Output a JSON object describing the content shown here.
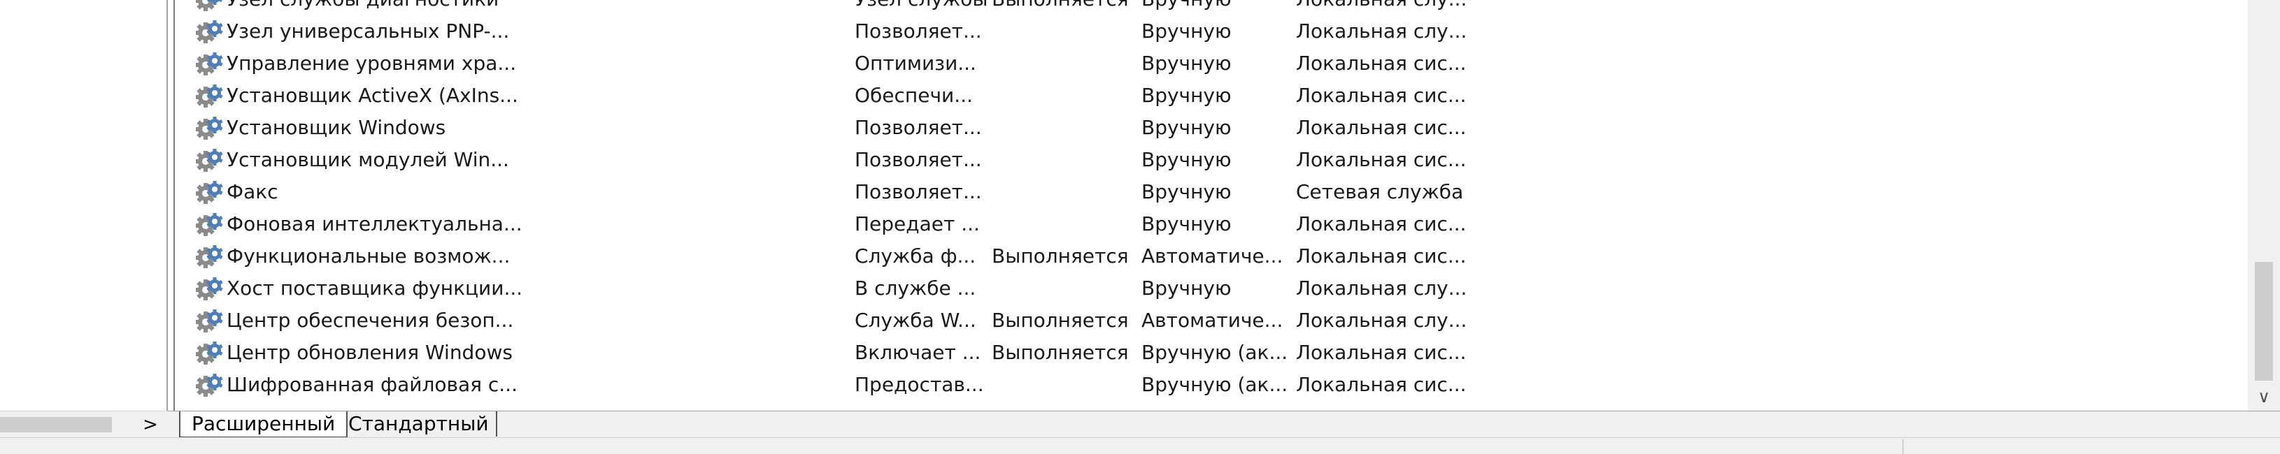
{
  "services": [
    {
      "name": "Узел службы диагностики",
      "description": "Узел службы",
      "state": "Выполняется",
      "startup": "Вручную",
      "logon": "Локальная слу..."
    },
    {
      "name": "Узел универсальных PNP-...",
      "description": "Позволяет...",
      "state": "",
      "startup": "Вручную",
      "logon": "Локальная слу..."
    },
    {
      "name": "Управление уровнями хра...",
      "description": "Оптимизи...",
      "state": "",
      "startup": "Вручную",
      "logon": "Локальная сис..."
    },
    {
      "name": "Установщик ActiveX (AxIns...",
      "description": "Обеспечи...",
      "state": "",
      "startup": "Вручную",
      "logon": "Локальная сис..."
    },
    {
      "name": "Установщик Windows",
      "description": "Позволяет...",
      "state": "",
      "startup": "Вручную",
      "logon": "Локальная сис..."
    },
    {
      "name": "Установщик модулей Win...",
      "description": "Позволяет...",
      "state": "",
      "startup": "Вручную",
      "logon": "Локальная сис..."
    },
    {
      "name": "Факс",
      "description": "Позволяет...",
      "state": "",
      "startup": "Вручную",
      "logon": "Сетевая служба"
    },
    {
      "name": "Фоновая интеллектуальна...",
      "description": "Передает ...",
      "state": "",
      "startup": "Вручную",
      "logon": "Локальная сис..."
    },
    {
      "name": "Функциональные возмож...",
      "description": "Служба ф...",
      "state": "Выполняется",
      "startup": "Автоматиче...",
      "logon": "Локальная сис..."
    },
    {
      "name": "Хост поставщика функции...",
      "description": "В службе ...",
      "state": "",
      "startup": "Вручную",
      "logon": "Локальная слу..."
    },
    {
      "name": "Центр обеспечения безоп...",
      "description": "Служба W...",
      "state": "Выполняется",
      "startup": "Автоматиче...",
      "logon": "Локальная слу..."
    },
    {
      "name": "Центр обновления Windows",
      "description": "Включает ...",
      "state": "Выполняется",
      "startup": "Вручную (ак...",
      "logon": "Локальная сис..."
    },
    {
      "name": "Шифрованная файловая с...",
      "description": "Предостав...",
      "state": "",
      "startup": "Вручную (ак...",
      "logon": "Локальная сис..."
    }
  ],
  "tabs": {
    "extended": "Расширенный",
    "standard": "Стандартный"
  },
  "icons": {
    "service": "gear-icon",
    "left_scroll_right": "chevron-right-icon",
    "list_scroll_down": "chevron-down-icon"
  },
  "symbols": {
    "scroll_right": ">",
    "scroll_down": "∨"
  },
  "colors": {
    "gear_blue": "#4f7fb8",
    "gear_gray": "#8a8a8a",
    "text": "#1a1a1a",
    "scrollbar": "#f0f0f0",
    "thumb": "#cdcdcd"
  }
}
